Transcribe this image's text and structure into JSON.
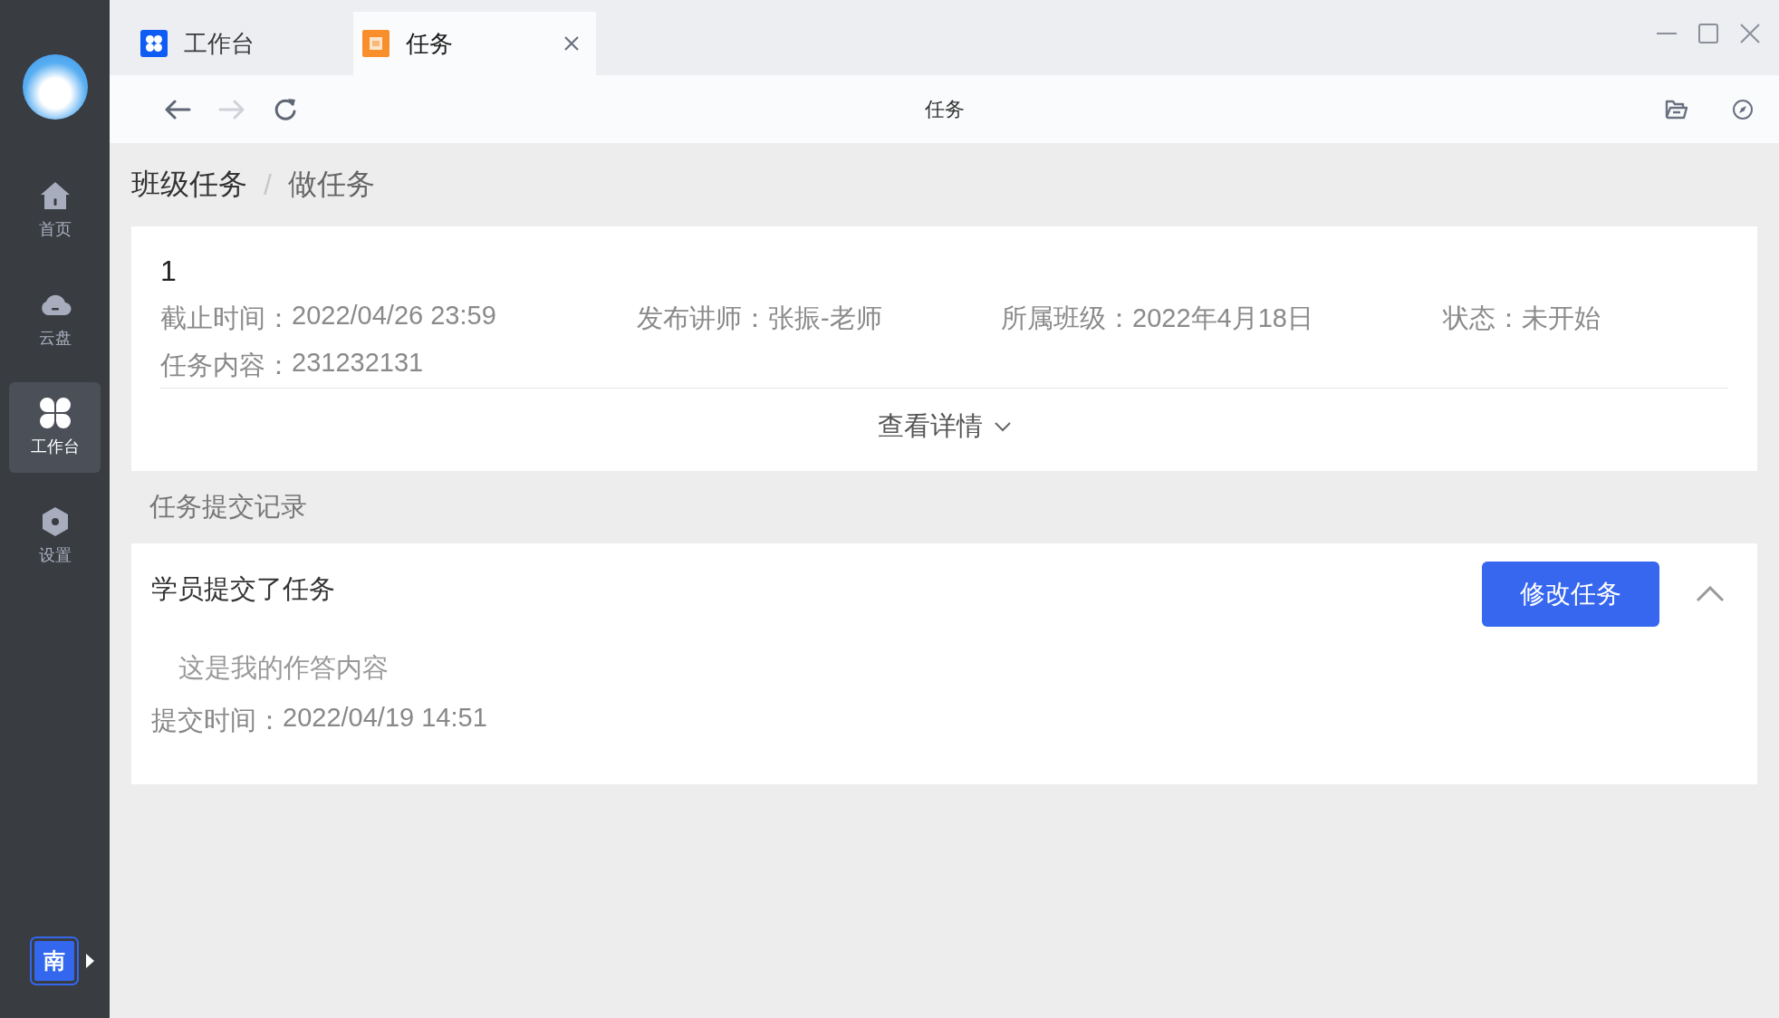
{
  "sidebar": {
    "items": [
      {
        "label": "首页",
        "kind": "home",
        "selected": false
      },
      {
        "label": "云盘",
        "kind": "cloud",
        "selected": false
      },
      {
        "label": "工作台",
        "kind": "grid",
        "selected": true
      },
      {
        "label": "设置",
        "kind": "settings",
        "selected": false
      }
    ],
    "user_badge": "南"
  },
  "tabs": [
    {
      "label": "工作台",
      "kind": "grid",
      "selected": false,
      "closable": false
    },
    {
      "label": "任务",
      "kind": "doc",
      "selected": true,
      "closable": true
    }
  ],
  "toolbar": {
    "title": "任务",
    "forward_disabled": true
  },
  "breadcrumb": {
    "items": [
      "班级任务",
      "做任务"
    ],
    "separator": "/"
  },
  "task": {
    "title": "1",
    "fields": [
      {
        "label": "截止时间：",
        "value": "2022/04/26 23:59"
      },
      {
        "label": "发布讲师：",
        "value": "张振-老师"
      },
      {
        "label": "所属班级：",
        "value": "2022年4月18日"
      },
      {
        "label": "状态：",
        "value": "未开始"
      }
    ],
    "content_label": "任务内容：",
    "content": "231232131",
    "details_link": "查看详情",
    "expanded": false
  },
  "submissions": {
    "title": "任务提交记录",
    "items": [
      {
        "heading": "学员提交了任务",
        "button": "修改任务",
        "expanded": true,
        "answer": "这是我的作答内容",
        "time_label": "提交时间：",
        "time": "2022/04/19 14:51"
      }
    ]
  }
}
